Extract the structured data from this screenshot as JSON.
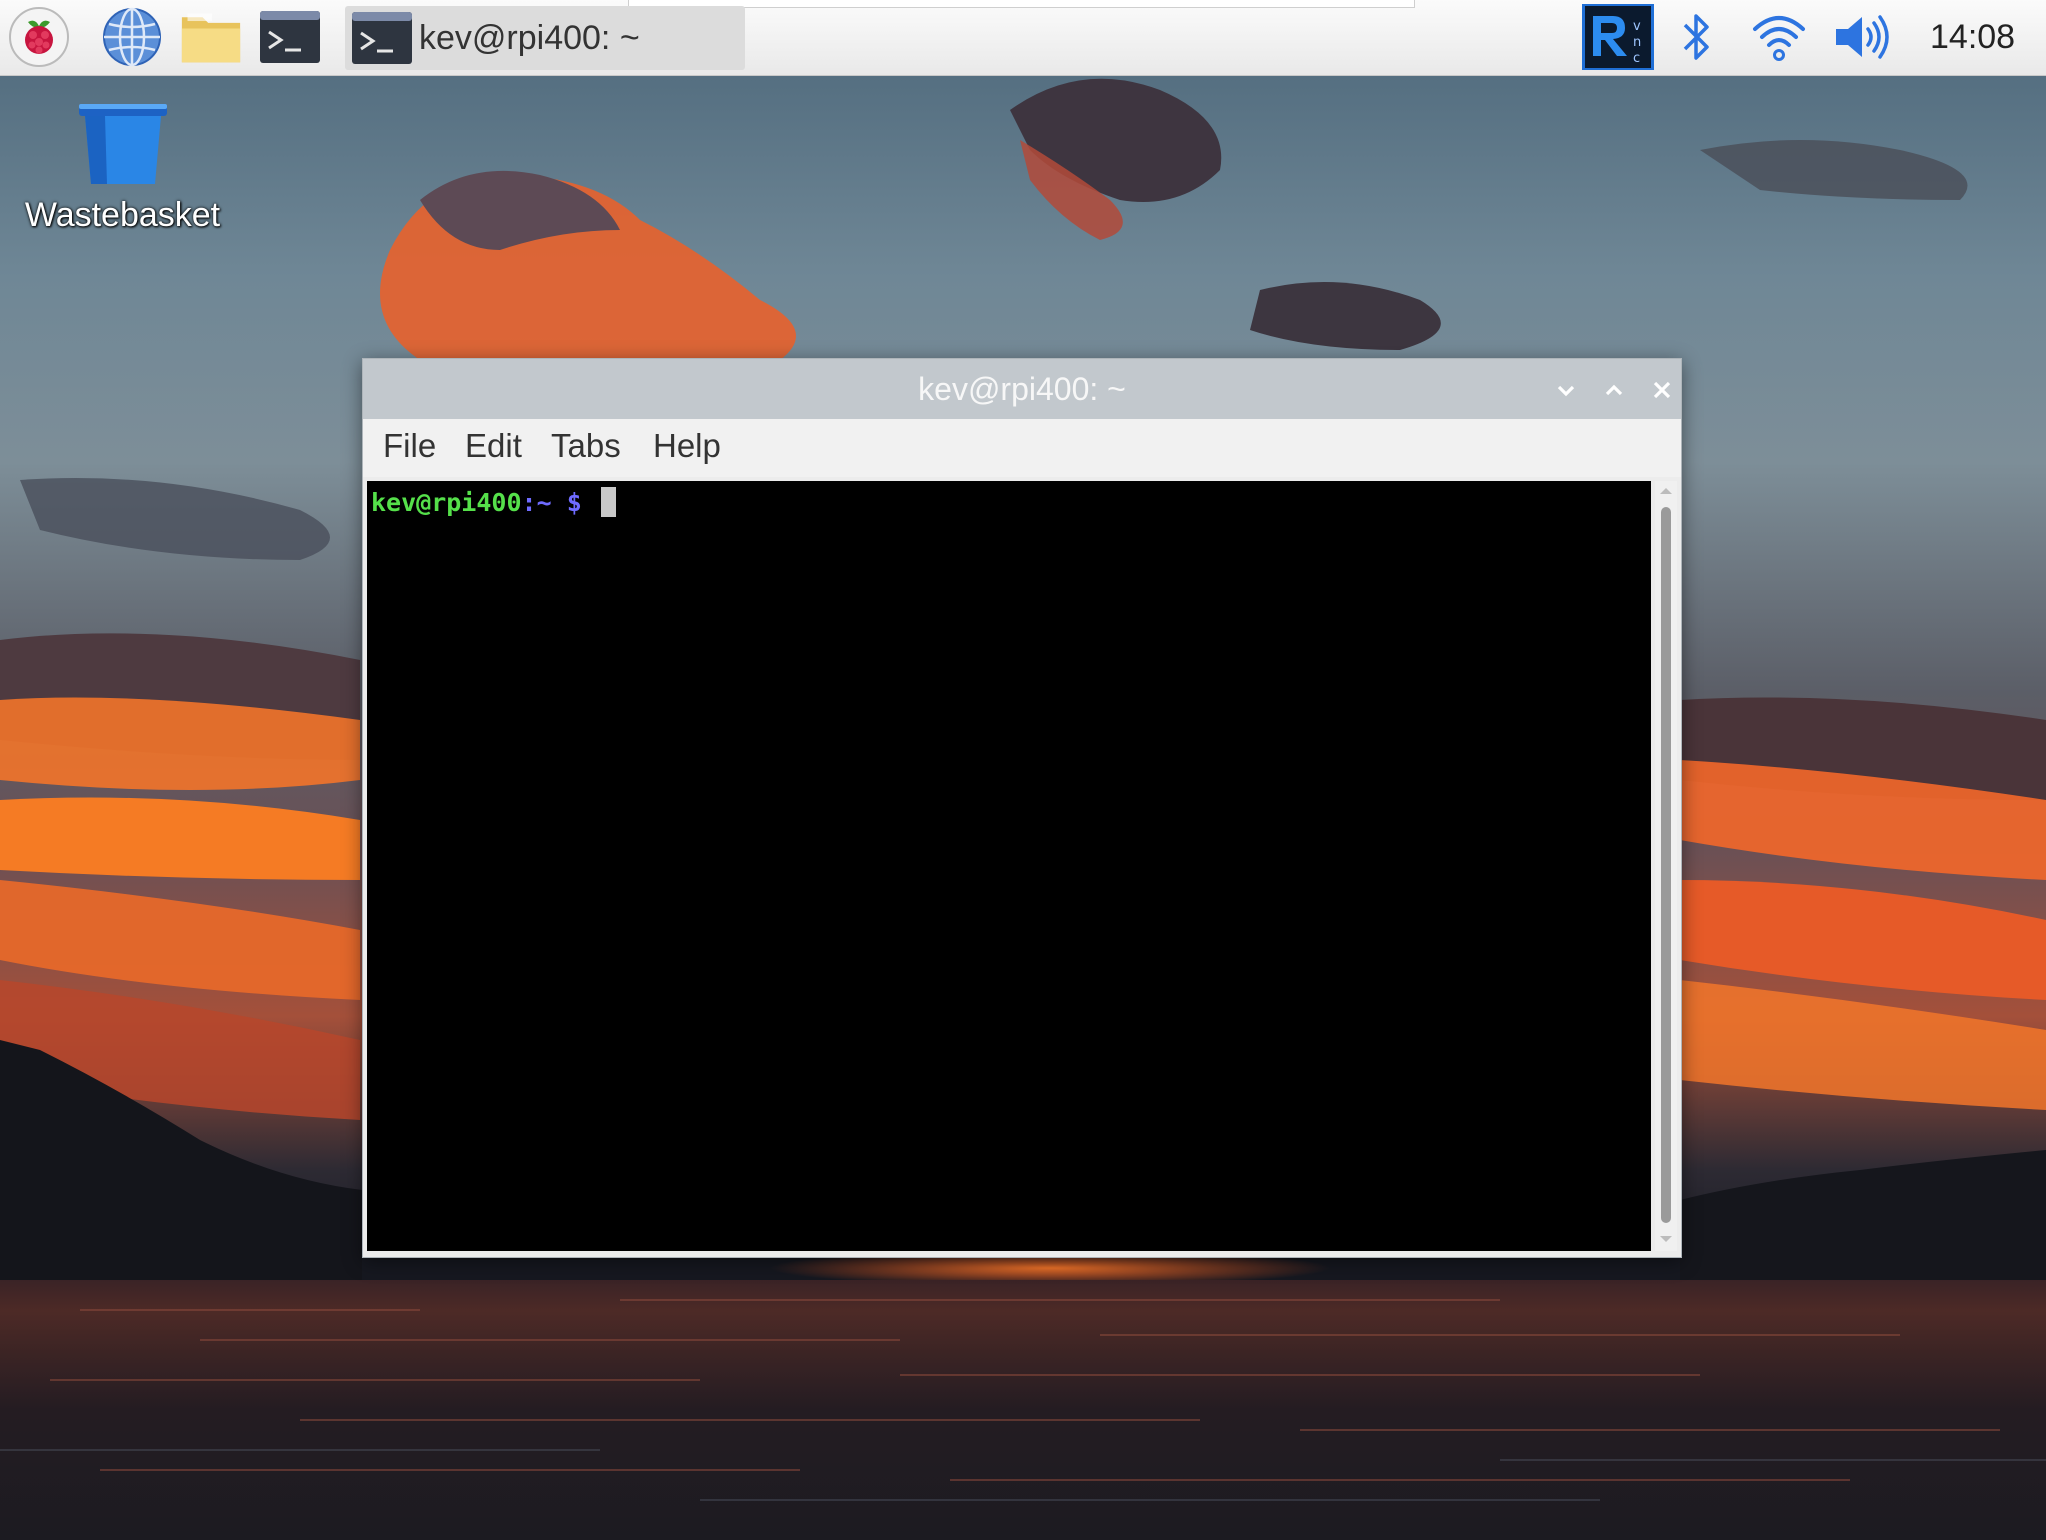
{
  "colors": {
    "prompt_user": "#55e04a",
    "prompt_dollar": "#6f6bff",
    "panel_bg": "#efefef",
    "titlebar_bg": "#c2c8cd"
  },
  "panel": {
    "launchers": [
      {
        "name": "raspberry-menu",
        "icon": "raspberry-icon"
      },
      {
        "name": "web-browser",
        "icon": "globe-icon"
      },
      {
        "name": "file-manager",
        "icon": "folder-icon"
      },
      {
        "name": "terminal",
        "icon": "terminal-icon"
      }
    ],
    "task": {
      "label": "kev@rpi400: ~",
      "icon": "terminal-icon"
    },
    "tray": {
      "vnc_icon": "vnc-icon",
      "bluetooth_icon": "bluetooth-icon",
      "wifi_icon": "wifi-icon",
      "volume_icon": "volume-icon"
    },
    "clock": "14:08"
  },
  "desktop": {
    "icons": [
      {
        "label": "Wastebasket",
        "icon": "wastebasket-icon"
      }
    ]
  },
  "window": {
    "title": "kev@rpi400: ~",
    "controls": [
      "minimize-icon",
      "maximize-icon",
      "close-icon"
    ],
    "menu": [
      "File",
      "Edit",
      "Tabs",
      "Help"
    ],
    "terminal": {
      "prompt_user": "kev@rpi400",
      "prompt_path": ":~",
      "prompt_symbol": "$"
    }
  }
}
